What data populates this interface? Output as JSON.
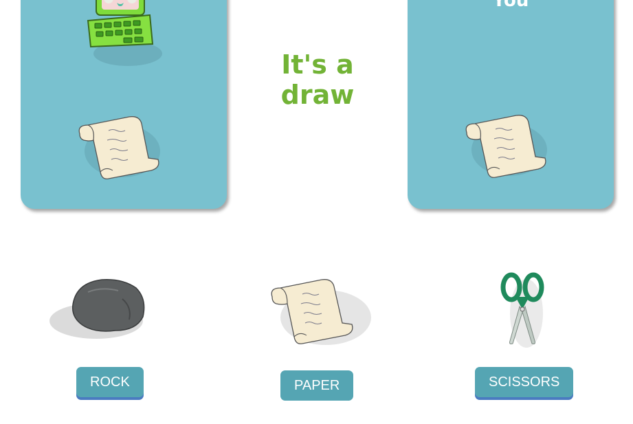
{
  "computer_panel": {
    "pick": "paper",
    "avatar": "computer-icon"
  },
  "you_panel": {
    "label": "You",
    "pick": "paper"
  },
  "result": {
    "line1": "It's a",
    "line2": "draw"
  },
  "choices": [
    {
      "id": "rock",
      "label": "ROCK",
      "icon": "rock-icon"
    },
    {
      "id": "paper",
      "label": "PAPER",
      "icon": "paper-scroll-icon"
    },
    {
      "id": "scissors",
      "label": "SCISSORS",
      "icon": "scissors-icon"
    }
  ],
  "colors": {
    "panel": "#79c1cf",
    "result_text": "#72b336",
    "button": "#55a5b3",
    "button_shadow": "#4a7bc0"
  }
}
